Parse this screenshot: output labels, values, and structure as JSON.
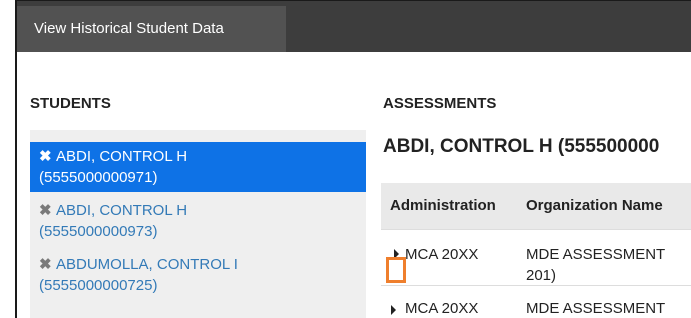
{
  "header": {
    "tab_label": "View Historical Student Data"
  },
  "students": {
    "title": "STUDENTS",
    "items": [
      {
        "name": "ABDI, CONTROL H",
        "id": "(5555000000971)",
        "active": true
      },
      {
        "name": "ABDI, CONTROL H",
        "id": "(5555000000973)",
        "active": false
      },
      {
        "name": "ABDUMOLLA, CONTROL I",
        "id": "(5555000000725)",
        "active": false
      }
    ]
  },
  "assessments": {
    "title": "ASSESSMENTS",
    "student_heading": "ABDI, CONTROL H (555500000",
    "table": {
      "columns": [
        "Administration",
        "Organization Name"
      ],
      "rows": [
        {
          "administration": "MCA 20XX",
          "organization_line1": "MDE ASSESSMENT",
          "organization_line2": "201)"
        },
        {
          "administration": "MCA 20XX",
          "organization_line1": "MDE ASSESSMENT",
          "organization_line2": ""
        }
      ]
    }
  },
  "icons": {
    "remove": "x-icon",
    "expand": "caret-right-icon"
  },
  "colors": {
    "active_bg": "#0e72e6",
    "link": "#337ab7",
    "highlight": "#ef7f2d",
    "header_bg": "#3d3d3d"
  }
}
